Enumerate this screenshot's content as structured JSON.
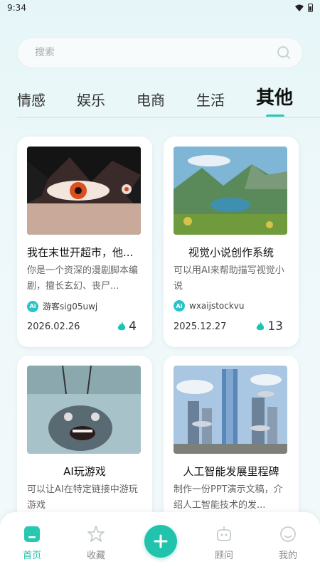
{
  "status": {
    "time": "9:34"
  },
  "search": {
    "placeholder": "搜索"
  },
  "tabs": [
    "情感",
    "娱乐",
    "电商",
    "生活",
    "其他"
  ],
  "active_tab": "其他",
  "cards": [
    {
      "title": "我在末世开超市，他...",
      "desc": "你是一个资深的漫剧脚本编剧，擅长玄幻、丧尸...",
      "author": "游客sig05uwj",
      "date": "2026.02.26",
      "hot": "4",
      "image": "anime-eye"
    },
    {
      "title": "视觉小说创作系统",
      "desc": "可以用AI来帮助描写视觉小说",
      "author": "wxaijstockvu",
      "date": "2025.12.27",
      "hot": "13",
      "image": "landscape-lake"
    },
    {
      "title": "AI玩游戏",
      "desc": "可以让AI在特定链接中游玩游戏",
      "author": "",
      "date": "",
      "hot": "",
      "image": "cartoon-monster"
    },
    {
      "title": "人工智能发展里程碑",
      "desc": "制作一份PPT演示文稿，介绍人工智能技术的发...",
      "author": "",
      "date": "",
      "hot": "",
      "image": "future-city"
    }
  ],
  "ai_badge": "Ai",
  "nav": {
    "home": "首页",
    "favorites": "收藏",
    "advisor": "顾问",
    "mine": "我的"
  },
  "colors": {
    "accent": "#22c3ad",
    "badge": "#29c4c9",
    "flame": "#1fc3b0"
  },
  "icons": [
    "wifi-icon",
    "battery-icon",
    "search-icon",
    "flame-icon",
    "home-icon",
    "star-icon",
    "plus-icon",
    "robot-icon",
    "smile-icon"
  ]
}
